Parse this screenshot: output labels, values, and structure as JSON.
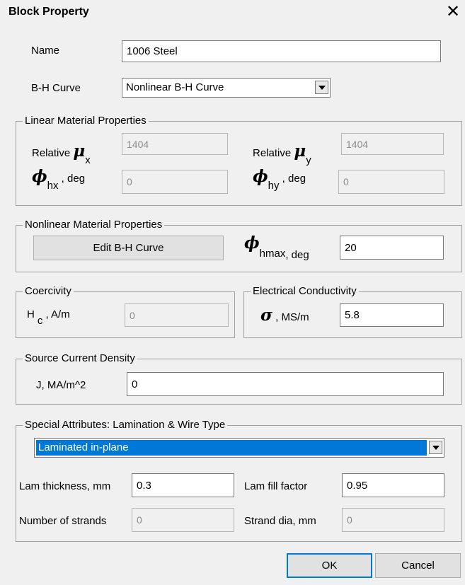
{
  "window": {
    "title": "Block Property",
    "close_glyph": "✕"
  },
  "name_label": "Name",
  "name_value": "1006 Steel",
  "bh_label": "B-H Curve",
  "bh_value": "Nonlinear B-H Curve",
  "linear": {
    "legend": "Linear Material Properties",
    "relative": "Relative",
    "mu_symbol": "μ",
    "sub_x": "x",
    "sub_y": "y",
    "mux_value": "1404",
    "muy_value": "1404",
    "phi_symbol": "ϕ",
    "sub_hx": "hx",
    "sub_hy": "hy",
    "deg_unit": ", deg",
    "phihx_value": "0",
    "phihy_value": "0"
  },
  "nonlinear": {
    "legend": "Nonlinear Material Properties",
    "edit_button": "Edit B-H Curve",
    "phi_symbol": "ϕ",
    "sub_hmax": "hmax",
    "deg_unit": ", deg",
    "phihmax_value": "20"
  },
  "coercivity": {
    "legend": "Coercivity",
    "h_label": "H",
    "h_sub": "c",
    "unit": ", A/m",
    "value": "0"
  },
  "conductivity": {
    "legend": "Electrical Conductivity",
    "sigma_symbol": "σ",
    "unit": ", MS/m",
    "value": "5.8"
  },
  "source": {
    "legend": "Source Current Density",
    "label": "J, MA/m^2",
    "value": "0"
  },
  "special": {
    "legend": "Special Attributes:  Lamination & Wire Type",
    "selected": "Laminated in-plane",
    "lam_thickness_label": "Lam thickness, mm",
    "lam_thickness_value": "0.3",
    "lam_fill_label": "Lam fill factor",
    "lam_fill_value": "0.95",
    "strands_label": "Number of strands",
    "strands_value": "0",
    "strand_dia_label": "Strand dia, mm",
    "strand_dia_value": "0"
  },
  "buttons": {
    "ok": "OK",
    "cancel": "Cancel"
  },
  "colors": {
    "selection": "#0078d7",
    "background": "#f0f0f0"
  }
}
